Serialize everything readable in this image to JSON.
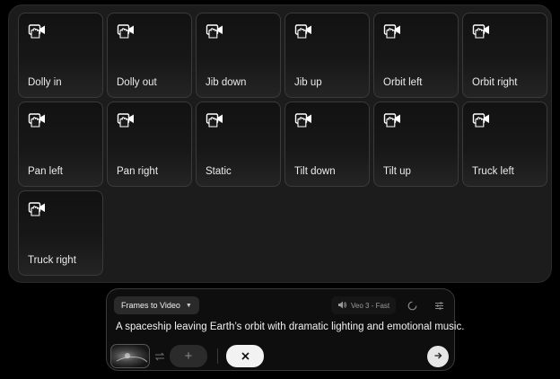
{
  "camera_tiles": [
    {
      "label": "Dolly in",
      "icon": "camera-motion-icon"
    },
    {
      "label": "Dolly out",
      "icon": "camera-motion-icon"
    },
    {
      "label": "Jib down",
      "icon": "camera-motion-icon"
    },
    {
      "label": "Jib up",
      "icon": "camera-motion-icon"
    },
    {
      "label": "Orbit left",
      "icon": "camera-motion-icon"
    },
    {
      "label": "Orbit right",
      "icon": "camera-motion-icon"
    },
    {
      "label": "Pan left",
      "icon": "camera-motion-icon"
    },
    {
      "label": "Pan right",
      "icon": "camera-motion-icon"
    },
    {
      "label": "Static",
      "icon": "camera-motion-icon"
    },
    {
      "label": "Tilt down",
      "icon": "camera-motion-icon"
    },
    {
      "label": "Tilt up",
      "icon": "camera-motion-icon"
    },
    {
      "label": "Truck left",
      "icon": "camera-motion-icon"
    },
    {
      "label": "Truck right",
      "icon": "camera-motion-icon"
    }
  ],
  "composer": {
    "mode_label": "Frames to Video",
    "model_label": "Veo 3 - Fast",
    "prompt_text": "A spaceship leaving Earth’s orbit with dramatic lighting and emotional music.",
    "add_label": "+"
  },
  "colors": {
    "panel_bg": "#1c1c1c",
    "tile_border": "#3a3a3a",
    "text": "#ececec",
    "send_bg": "#e6e6e6"
  }
}
